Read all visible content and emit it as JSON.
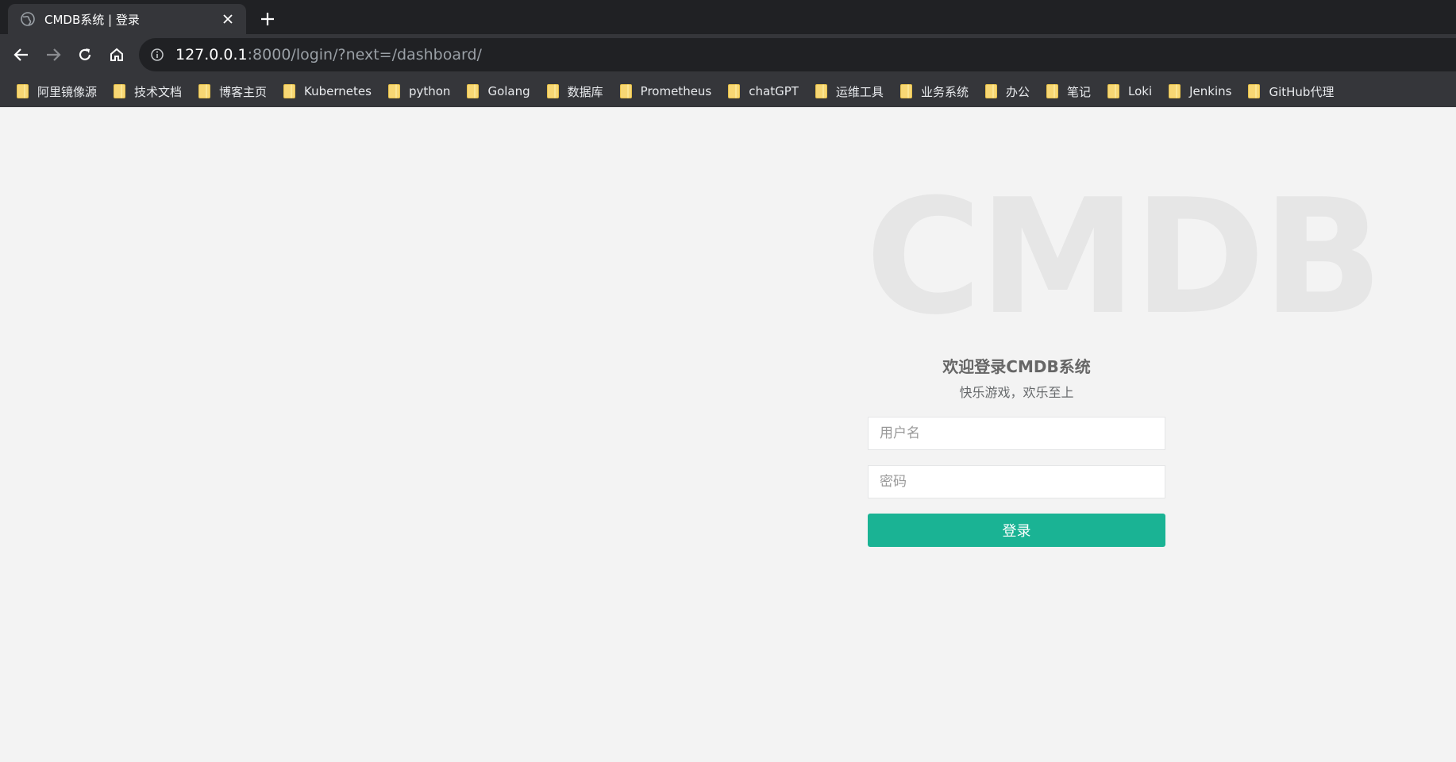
{
  "browser": {
    "tab": {
      "title": "CMDB系统 | 登录",
      "favicon": "globe-icon",
      "close": "close-icon"
    },
    "new_tab_icon": "plus-icon",
    "nav": {
      "back_icon": "arrow-left-icon",
      "forward_icon": "arrow-right-icon",
      "reload_icon": "reload-icon",
      "home_icon": "home-icon"
    },
    "address": {
      "host": "127.0.0.1",
      "rest": ":8000/login/?next=/dashboard/",
      "info_icon": "info-icon"
    },
    "bookmarks": [
      {
        "label": "阿里镜像源"
      },
      {
        "label": "技术文档"
      },
      {
        "label": "博客主页"
      },
      {
        "label": "Kubernetes"
      },
      {
        "label": "python"
      },
      {
        "label": "Golang"
      },
      {
        "label": "数据库"
      },
      {
        "label": "Prometheus"
      },
      {
        "label": "chatGPT"
      },
      {
        "label": "运维工具"
      },
      {
        "label": "业务系统"
      },
      {
        "label": "办公"
      },
      {
        "label": "笔记"
      },
      {
        "label": "Loki"
      },
      {
        "label": "Jenkins"
      },
      {
        "label": "GitHub代理"
      }
    ]
  },
  "page": {
    "watermark": "CMDB",
    "title": "欢迎登录CMDB系统",
    "subtitle": "快乐游戏，欢乐至上",
    "username": {
      "placeholder": "用户名",
      "value": ""
    },
    "password": {
      "placeholder": "密码",
      "value": ""
    },
    "submit_label": "登录"
  },
  "colors": {
    "chrome_dark": "#202124",
    "chrome_toolbar": "#35363a",
    "page_bg": "#f3f3f3",
    "accent": "#1ab394",
    "folder": "#f7d774"
  }
}
